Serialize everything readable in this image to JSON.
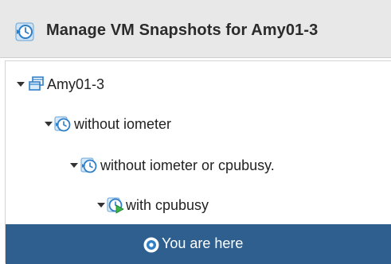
{
  "dialog": {
    "title": "Manage VM Snapshots for Amy01-3",
    "icon": "snapshot-clock-icon"
  },
  "tree": {
    "nodes": [
      {
        "label": "Amy01-3",
        "icon": "virtual-machine-icon",
        "expanded": true,
        "depth": 0
      },
      {
        "label": "without iometer",
        "icon": "snapshot-icon",
        "expanded": true,
        "depth": 1
      },
      {
        "label": "without iometer or cpubusy.",
        "icon": "snapshot-icon",
        "expanded": true,
        "depth": 2
      },
      {
        "label": "with cpubusy",
        "icon": "snapshot-running-icon",
        "expanded": true,
        "depth": 3
      },
      {
        "label": "You are here",
        "icon": "current-location-icon",
        "selected": true,
        "depth": 4
      }
    ]
  },
  "colors": {
    "header_bg": "#e8e8e8",
    "selection_bg": "#2e5f8f",
    "icon_blue": "#3a8fd6"
  }
}
